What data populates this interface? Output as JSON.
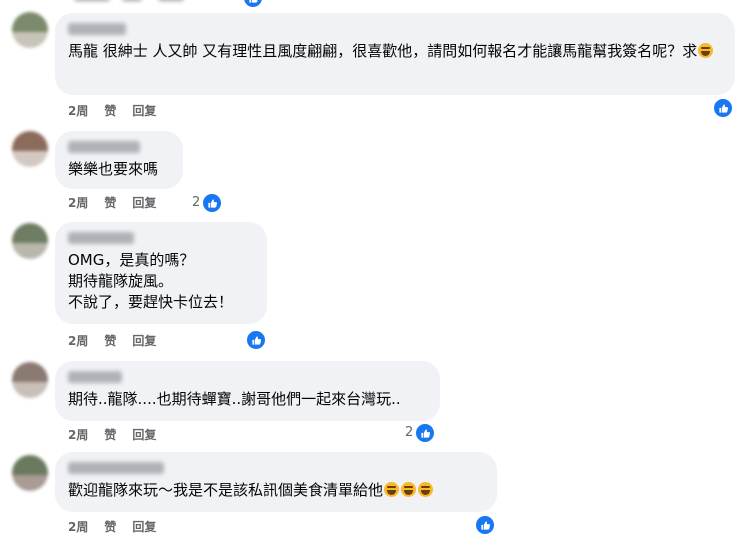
{
  "comments": [
    {
      "text": "馬龍 很紳士 人又帥 又有理性且風度翩翩，很喜歡他，請問如何報名才能讓馬龍幫我簽名呢？求",
      "emoji": "grinning-face-with-sweat",
      "time": "2周",
      "like_label": "赞",
      "reply_label": "回复",
      "reaction_count": "",
      "avatar_colors": [
        "#7a8a6a",
        "#c9c4b8"
      ]
    },
    {
      "text": "樂樂也要來嗎",
      "time": "2周",
      "like_label": "赞",
      "reply_label": "回复",
      "reaction_count": "2",
      "avatar_colors": [
        "#8b6b5c",
        "#d4c9c2"
      ]
    },
    {
      "text": "OMG，是真的嗎？\n期待龍隊旋風。\n不說了，要趕快卡位去！",
      "time": "2周",
      "like_label": "赞",
      "reply_label": "回复",
      "reaction_count": "",
      "avatar_colors": [
        "#6e7d63",
        "#b9b6ab"
      ]
    },
    {
      "text": "期待..龍隊....也期待蟬寶..謝哥他們一起來台灣玩..",
      "time": "2周",
      "like_label": "赞",
      "reply_label": "回复",
      "reaction_count": "2",
      "avatar_colors": [
        "#8a7a72",
        "#c7bfb8"
      ]
    },
    {
      "text": "歡迎龍隊來玩～我是不是該私訊個美食清單給他",
      "emoji": "rolling-on-the-floor-laughing x3",
      "time": "2周",
      "like_label": "赞",
      "reply_label": "回复",
      "reaction_count": "",
      "avatar_colors": [
        "#6a7a5e",
        "#a89c94"
      ]
    }
  ],
  "icons": {
    "like": "thumbs-up-icon",
    "like_color": "#1877f2"
  }
}
